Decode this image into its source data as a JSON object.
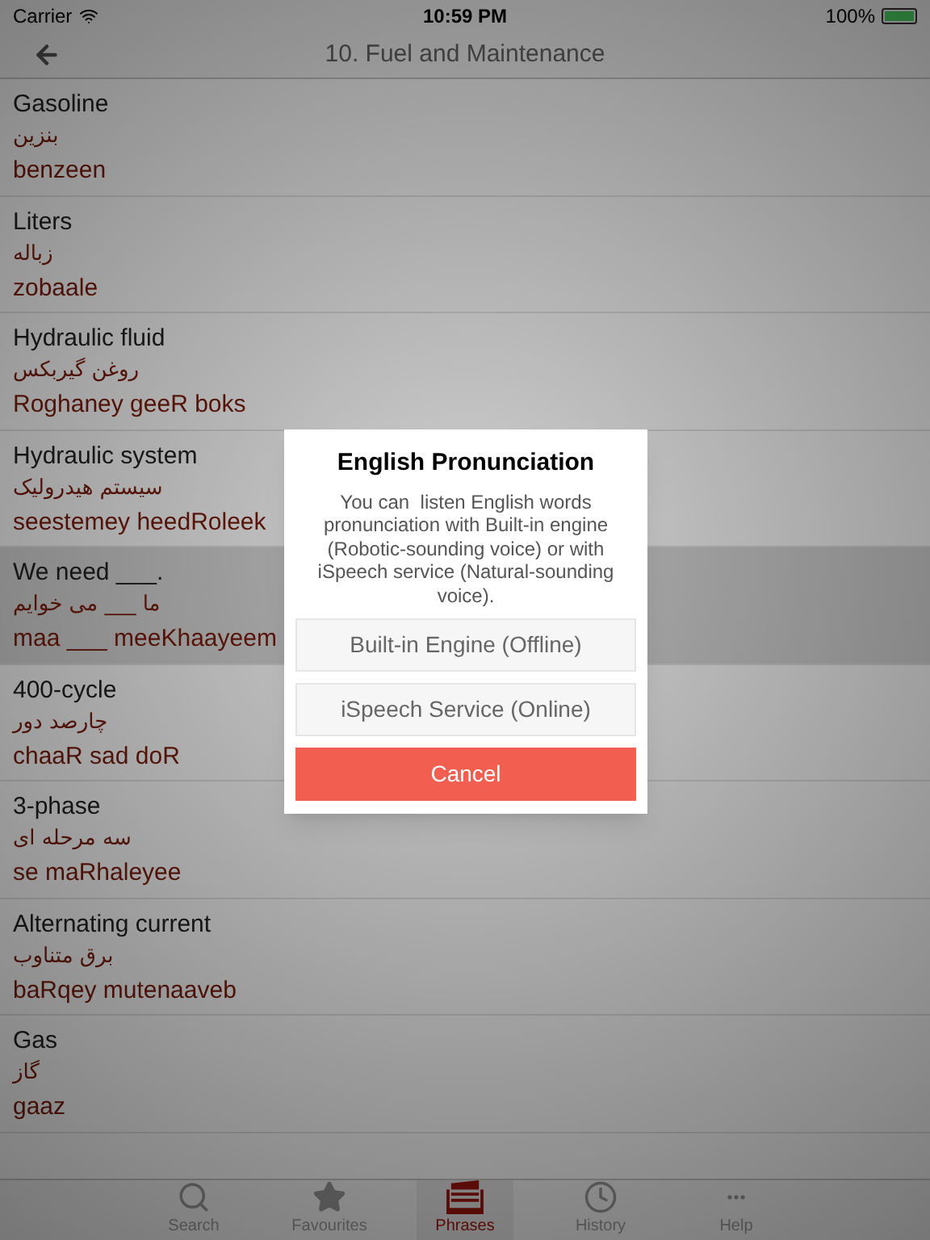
{
  "status_bar": {
    "carrier": "Carrier",
    "time": "10:59 PM",
    "battery": "100%"
  },
  "nav_bar": {
    "title": "10. Fuel and Maintenance"
  },
  "phrases": [
    {
      "english": "Gasoline",
      "persian": "بنزین",
      "transliteration": "benzeen",
      "selected": false
    },
    {
      "english": "Liters",
      "persian": "زباله",
      "transliteration": "zobaale",
      "selected": false
    },
    {
      "english": "Hydraulic fluid",
      "persian": "روغن گیربکس",
      "transliteration": "Roghaney geeR boks",
      "selected": false
    },
    {
      "english": "Hydraulic system",
      "persian": "سیستم هیدرولیک",
      "transliteration": "seestemey heedRoleek",
      "selected": false
    },
    {
      "english": "We need ___.",
      "persian": "ما ___ می خوایم",
      "transliteration": "maa ___ meeKhaayeem",
      "selected": true
    },
    {
      "english": "400-cycle",
      "persian": "چارصد دور",
      "transliteration": "chaaR sad doR",
      "selected": false
    },
    {
      "english": "3-phase",
      "persian": "سه مرحله ای",
      "transliteration": "se maRhaleyee",
      "selected": false
    },
    {
      "english": "Alternating current",
      "persian": "برق متناوب",
      "transliteration": "baRqey mutenaaveb",
      "selected": false
    },
    {
      "english": "Gas",
      "persian": "گاز",
      "transliteration": "gaaz",
      "selected": false
    }
  ],
  "dialog": {
    "title": "English Pronunciation",
    "message": "You can  listen English words pronunciation with Built-in engine (Robotic-sounding voice) or with iSpeech service (Natural-sounding voice).",
    "buttons": [
      {
        "label": "Built-in Engine (Offline)",
        "kind": "option"
      },
      {
        "label": "iSpeech Service (Online)",
        "kind": "option"
      },
      {
        "label": "Cancel",
        "kind": "cancel"
      }
    ]
  },
  "tab_bar": [
    {
      "label": "Search",
      "kind": "search",
      "selected": false
    },
    {
      "label": "Favourites",
      "kind": "favourites",
      "selected": false
    },
    {
      "label": "Phrases",
      "kind": "phrases",
      "selected": true
    },
    {
      "label": "History",
      "kind": "history",
      "selected": false
    },
    {
      "label": "Help",
      "kind": "help",
      "selected": false
    }
  ]
}
